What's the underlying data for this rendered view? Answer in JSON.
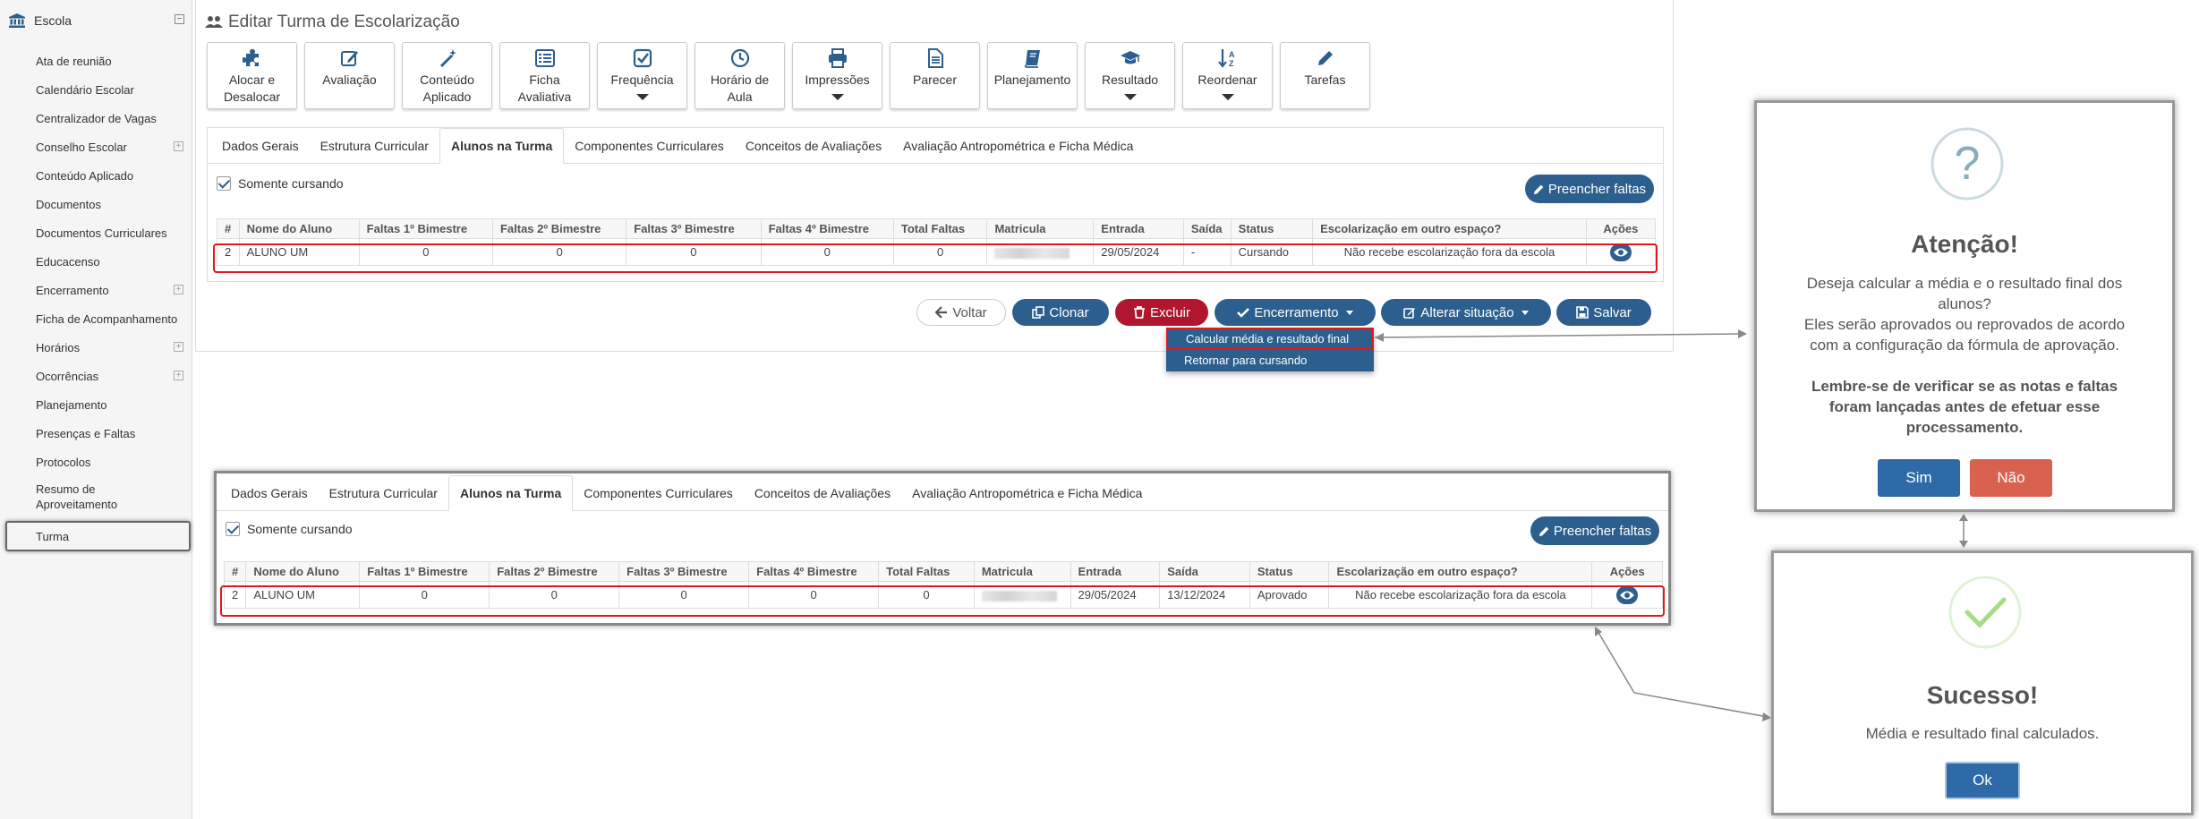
{
  "sidebar": {
    "school_label": "Escola",
    "items": [
      {
        "label": "Ata de reunião",
        "expandable": false
      },
      {
        "label": "Calendário Escolar",
        "expandable": false
      },
      {
        "label": "Centralizador de Vagas",
        "expandable": false
      },
      {
        "label": "Conselho Escolar",
        "expandable": true
      },
      {
        "label": "Conteúdo Aplicado",
        "expandable": false
      },
      {
        "label": "Documentos",
        "expandable": false
      },
      {
        "label": "Documentos Curriculares",
        "expandable": false
      },
      {
        "label": "Educacenso",
        "expandable": false
      },
      {
        "label": "Encerramento",
        "expandable": true
      },
      {
        "label": "Ficha de Acompanhamento",
        "expandable": false
      },
      {
        "label": "Horários",
        "expandable": true
      },
      {
        "label": "Ocorrências",
        "expandable": true
      },
      {
        "label": "Planejamento",
        "expandable": false
      },
      {
        "label": "Presenças e Faltas",
        "expandable": false
      },
      {
        "label": "Protocolos",
        "expandable": false
      },
      {
        "label": "Resumo de Aproveitamento",
        "expandable": false
      },
      {
        "label": "Turma",
        "expandable": false,
        "active": true
      }
    ]
  },
  "page": {
    "title": "Editar Turma de Escolarização"
  },
  "toolbar": {
    "buttons": [
      {
        "label": "Alocar e Desalocar",
        "icon": "puzzle-icon",
        "dropdown": false
      },
      {
        "label": "Avaliação",
        "icon": "edit-icon",
        "dropdown": false
      },
      {
        "label": "Conteúdo Aplicado",
        "icon": "magic-wand-icon",
        "dropdown": false
      },
      {
        "label": "Ficha Avaliativa",
        "icon": "list-alt-icon",
        "dropdown": false
      },
      {
        "label": "Frequência",
        "icon": "check-square-icon",
        "dropdown": true
      },
      {
        "label": "Horário de Aula",
        "icon": "clock-icon",
        "dropdown": false
      },
      {
        "label": "Impressões",
        "icon": "printer-icon",
        "dropdown": true
      },
      {
        "label": "Parecer",
        "icon": "file-text-icon",
        "dropdown": false
      },
      {
        "label": "Planejamento",
        "icon": "book-icon",
        "dropdown": false
      },
      {
        "label": "Resultado",
        "icon": "graduation-cap-icon",
        "dropdown": true
      },
      {
        "label": "Reordenar",
        "icon": "sort-alpha-icon",
        "dropdown": true
      },
      {
        "label": "Tarefas",
        "icon": "pencil-icon",
        "dropdown": false
      }
    ]
  },
  "tabs": [
    "Dados Gerais",
    "Estrutura Curricular",
    "Alunos na Turma",
    "Componentes Curriculares",
    "Conceitos de Avaliações",
    "Avaliação Antropométrica e Ficha Médica"
  ],
  "active_tab": "Alunos na Turma",
  "filter": {
    "label": "Somente cursando",
    "checked": true
  },
  "fill_absences_label": "Preencher faltas",
  "table": {
    "headers": [
      "#",
      "Nome do Aluno",
      "Faltas 1º Bimestre",
      "Faltas 2º Bimestre",
      "Faltas 3º Bimestre",
      "Faltas 4º Bimestre",
      "Total Faltas",
      "Matricula",
      "Entrada",
      "Saída",
      "Status",
      "Escolarização em outro espaço?",
      "Ações"
    ]
  },
  "row_before": {
    "num": "2",
    "name": "ALUNO UM",
    "f1": "0",
    "f2": "0",
    "f3": "0",
    "f4": "0",
    "total": "0",
    "entrada": "29/05/2024",
    "saida": "-",
    "status": "Cursando",
    "outro_espaco": "Não recebe escolarização fora da escola"
  },
  "row_after": {
    "num": "2",
    "name": "ALUNO UM",
    "f1": "0",
    "f2": "0",
    "f3": "0",
    "f4": "0",
    "total": "0",
    "entrada": "29/05/2024",
    "saida": "13/12/2024",
    "status": "Aprovado",
    "outro_espaco": "Não recebe escolarização fora da escola"
  },
  "actions": {
    "voltar": "Voltar",
    "clonar": "Clonar",
    "excluir": "Excluir",
    "encerramento": "Encerramento",
    "alterar_situacao": "Alterar situação",
    "salvar": "Salvar"
  },
  "dropdown_options": [
    "Calcular média e resultado final",
    "Retornar para cursando"
  ],
  "confirm_modal": {
    "icon_symbol": "?",
    "title": "Atenção!",
    "message_lines": [
      "Deseja calcular a média e o resultado final dos",
      "alunos?",
      "Eles serão aprovados ou reprovados de acordo",
      "com a configuração da fórmula de aprovação."
    ],
    "warning_lines": [
      "Lembre-se de verificar se as notas e faltas",
      "foram lançadas antes de efetuar esse",
      "processamento."
    ],
    "yes": "Sim",
    "no": "Não"
  },
  "success_modal": {
    "title": "Sucesso!",
    "message": "Média e resultado final calculados.",
    "ok": "Ok"
  },
  "colors": {
    "primary": "#2c5f8e",
    "danger": "#b0172e",
    "confirm_blue": "#2e6aa7",
    "cancel_red": "#d9614f",
    "highlight_red": "#e0191f",
    "success_green": "#a5dc86"
  }
}
